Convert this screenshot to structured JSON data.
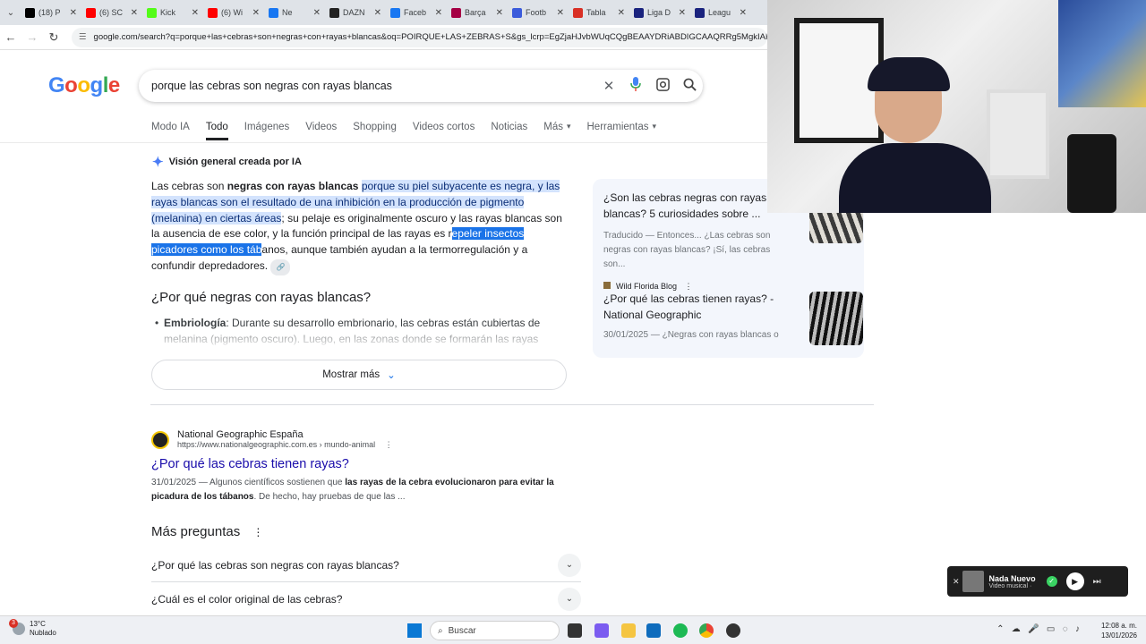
{
  "browser": {
    "tabs": [
      {
        "label": "(18) P",
        "icon": "x-icon",
        "color": "#000000"
      },
      {
        "label": "(6) SC",
        "icon": "youtube-icon",
        "color": "#ff0000"
      },
      {
        "label": "Kick",
        "icon": "kick-icon",
        "color": "#53fc18"
      },
      {
        "label": "(6) Wi",
        "icon": "youtube-icon",
        "color": "#ff0000"
      },
      {
        "label": "Ne",
        "icon": "facebook-icon",
        "color": "#1877f2"
      },
      {
        "label": "DAZN",
        "icon": "dazn-icon",
        "color": "#222222"
      },
      {
        "label": "Faceb",
        "icon": "facebook-icon",
        "color": "#1877f2"
      },
      {
        "label": "Barça",
        "icon": "barca-icon",
        "color": "#a50044"
      },
      {
        "label": "Footb",
        "icon": "football-icon",
        "color": "#3b5bdb"
      },
      {
        "label": "Tabla",
        "icon": "table-icon",
        "color": "#d93025"
      },
      {
        "label": "Liga D",
        "icon": "liga-icon",
        "color": "#1a237e"
      },
      {
        "label": "Leagu",
        "icon": "league-icon",
        "color": "#1a237e"
      }
    ],
    "url": "google.com/search?q=porque+las+cebras+son+negras+con+rayas+blancas&oq=POIRQUE+LAS+ZEBRAS+S&gs_lcrp=EgZjaHJvbWUqCQgBEAAYDRiABDIGCAAQRRg5MgkIARAAGA0"
  },
  "search": {
    "logo": "Google",
    "query": "porque las cebras son negras con rayas blancas",
    "filters": [
      "Modo IA",
      "Todo",
      "Imágenes",
      "Videos",
      "Shopping",
      "Videos cortos",
      "Noticias",
      "Más",
      "Herramientas"
    ],
    "active_filter": "Todo"
  },
  "ai_overview": {
    "header": "Visión general creada por IA",
    "p1": "Las cebras son ",
    "p1_bold": "negras con rayas blancas",
    "p1_space": " ",
    "p1_highlight": "porque su piel subyacente es negra, y las rayas blancas son el resultado de una inhibición en la producción de pigmento (melanina) en ciertas áreas",
    "p1_rest": "; su pelaje es originalmente oscuro y las rayas blancas son la ausencia de ese color, y la función principal de las rayas es r",
    "p1_selected": "epeler insectos picadores como los táb",
    "p1_end": "anos, aunque también ayudan a la termorregulación y a confundir depredadores.",
    "h2": "¿Por qué negras con rayas blancas?",
    "bullet_bold": "Embriología",
    "bullet_text": ": Durante su desarrollo embrionario, las cebras están cubiertas de melanina (pigmento oscuro). Luego, en las zonas donde se formarán las rayas",
    "show_more": "Mostrar más"
  },
  "sources": [
    {
      "title": "¿Son las cebras negras con rayas blancas? 5 curiosidades sobre ...",
      "snippet": "Traducido — Entonces... ¿Las cebras son negras con rayas blancas? ¡Sí, las cebras son...",
      "site": "Wild Florida Blog"
    },
    {
      "title": "¿Por qué las cebras tienen rayas? - National Geographic",
      "snippet": "30/01/2025 — ¿Negras con rayas blancas o"
    }
  ],
  "result": {
    "site_name": "National Geographic España",
    "site_url": "https://www.nationalgeographic.com.es › mundo-animal",
    "title": "¿Por qué las cebras tienen rayas?",
    "date": "31/01/2025 — Algunos científicos sostienen que ",
    "bold1": "las rayas de la cebra evolucionaron para evitar la picadura de los tábanos",
    "rest": ". De hecho, hay pruebas de que las ..."
  },
  "more_questions": {
    "heading": "Más preguntas",
    "items": [
      "¿Por qué las cebras son negras con rayas blancas?",
      "¿Cuál es el color original de las cebras?"
    ]
  },
  "player": {
    "title": "Nada Nuevo",
    "subtitle": "Video musical ·"
  },
  "taskbar": {
    "temp": "13°C",
    "weather": "Nublado",
    "badge": "3",
    "search": "Buscar",
    "time": "12:08 a. m.",
    "date": "13/01/2026"
  },
  "colors": {
    "accent": "#1a73e8",
    "link": "#1a0dab",
    "highlight": "#d3e3fd"
  }
}
